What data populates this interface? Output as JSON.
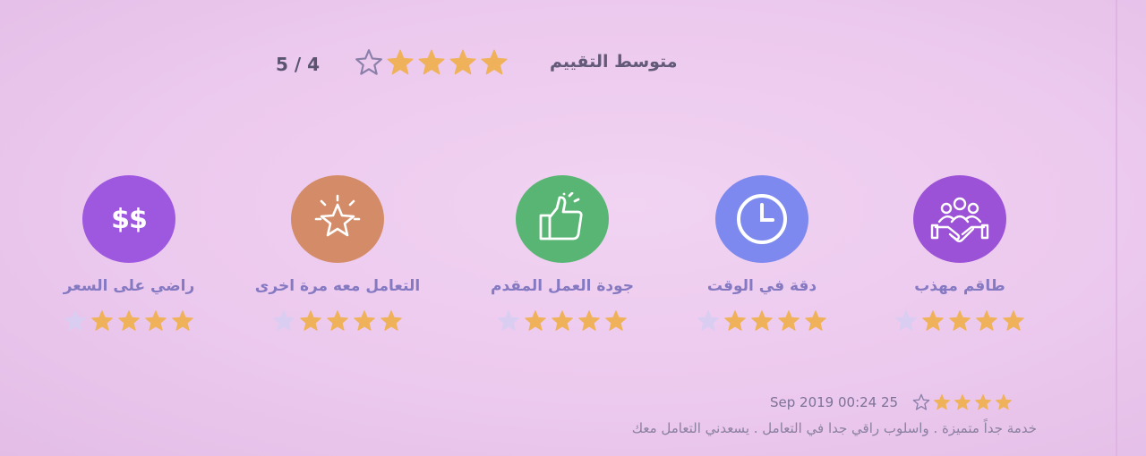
{
  "average": {
    "title": "متوسط التقييم",
    "score_text": "5 / 4",
    "rating": 4,
    "max": 5
  },
  "categories": [
    {
      "label": "طاقم مهذب",
      "icon": "people-handshake-icon",
      "color": "#9c52d6",
      "rating": 4
    },
    {
      "label": "دقة في الوقت",
      "icon": "clock-icon",
      "color": "#7d89ee",
      "rating": 4
    },
    {
      "label": "جودة العمل المقدم",
      "icon": "thumbs-up-icon",
      "color": "#58b573",
      "rating": 4
    },
    {
      "label": "التعامل معه مرة اخرى",
      "icon": "star-outline-icon",
      "color": "#d48c68",
      "rating": 4
    },
    {
      "label": "راضي على السعر",
      "icon": "dollar-icon",
      "color": "#9e58e0",
      "icon_text": "$$",
      "rating": 4
    }
  ],
  "review": {
    "date": "Sep 2019 00:24 25",
    "rating": 4,
    "text": "خدمة جداً متميزة . واسلوب راقي جدا في التعامل . يسعدني التعامل معك"
  },
  "colors": {
    "star_filled": "#efb25a",
    "star_empty_fill": "#d9cdf2",
    "star_outline": "#8a7fa8"
  }
}
